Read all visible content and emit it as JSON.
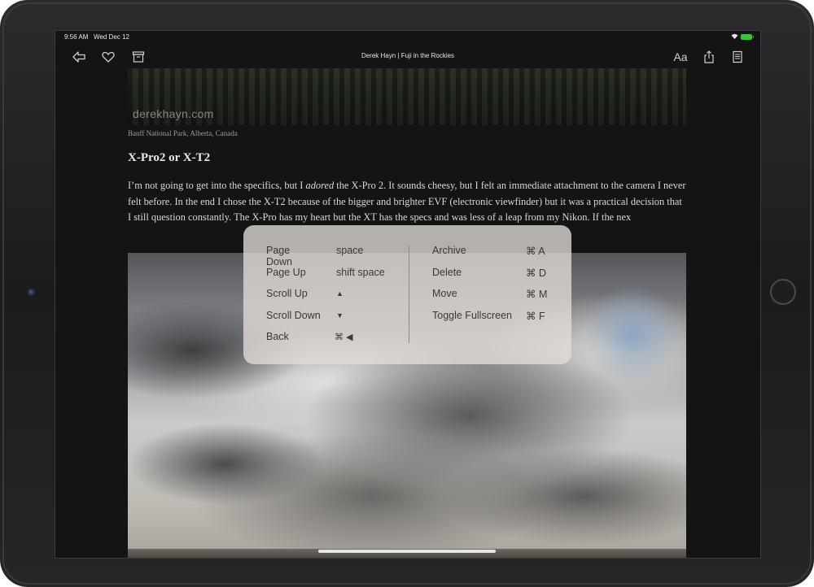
{
  "status": {
    "time": "9:56 AM",
    "date": "Wed Dec 12",
    "battery": "Ⅰ+≡"
  },
  "toolbar": {
    "title": "Derek Hayn | Fuji in the Rockies",
    "text_size_label": "Aa",
    "icons": [
      "back-icon",
      "heart-icon",
      "archive-icon",
      "text-size-icon",
      "share-icon",
      "reader-icon"
    ]
  },
  "article": {
    "watermark": "derekhayn.com",
    "caption": "Banff National Park, Alberta, Canada",
    "heading": "X-Pro2 or X-T2",
    "paragraph_start": "I’m not going to get into the specifics, but I ",
    "paragraph_em": "adored",
    "paragraph_rest": " the X-Pro 2. It sounds cheesy, but I felt an immediate attachment to the camera I never felt before. In the end I chose the X-T2 because of the bigger and brighter EVF (electronic viewfinder) but it was a practical decision that I still question constantly. The X-Pro has my heart but the XT has the specs and was less of a leap from my Nikon. If the nex"
  },
  "shortcuts": {
    "left": [
      {
        "label": "Page Down",
        "key": "space"
      },
      {
        "label": "Page Up",
        "key": "shift space"
      },
      {
        "label": "Scroll Up",
        "key": "▲"
      },
      {
        "label": "Scroll Down",
        "key": "▼"
      },
      {
        "label": "Back",
        "key": "⌘ ◀"
      }
    ],
    "right": [
      {
        "label": "Archive",
        "key": "⌘ A"
      },
      {
        "label": "Delete",
        "key": "⌘ D"
      },
      {
        "label": "Move",
        "key": "⌘ M"
      },
      {
        "label": "Toggle Fullscreen",
        "key": "⌘ F"
      }
    ]
  },
  "colors": {
    "screen_bg": "#141414",
    "overlay_bg": "#e1dcd7",
    "battery": "#3cc13b"
  }
}
